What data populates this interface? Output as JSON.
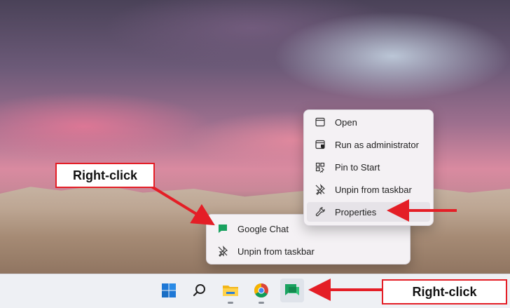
{
  "annotations": {
    "callout_top": "Right-click",
    "callout_bottom": "Right-click"
  },
  "jump_menu": {
    "items": [
      {
        "label": "Google Chat",
        "icon": "google-chat-icon"
      },
      {
        "label": "Unpin from taskbar",
        "icon": "unpin-icon"
      }
    ]
  },
  "context_menu": {
    "items": [
      {
        "label": "Open",
        "icon": "window-icon"
      },
      {
        "label": "Run as administrator",
        "icon": "shield-window-icon"
      },
      {
        "label": "Pin to Start",
        "icon": "pin-start-icon"
      },
      {
        "label": "Unpin from taskbar",
        "icon": "unpin-icon"
      },
      {
        "label": "Properties",
        "icon": "wrench-icon",
        "highlighted": true
      }
    ]
  },
  "taskbar": {
    "icons": [
      "windows-start-icon",
      "search-icon",
      "file-explorer-icon",
      "chrome-icon",
      "google-chat-icon"
    ]
  },
  "colors": {
    "accent_red": "#e41e26",
    "chat_green": "#1aa260"
  }
}
